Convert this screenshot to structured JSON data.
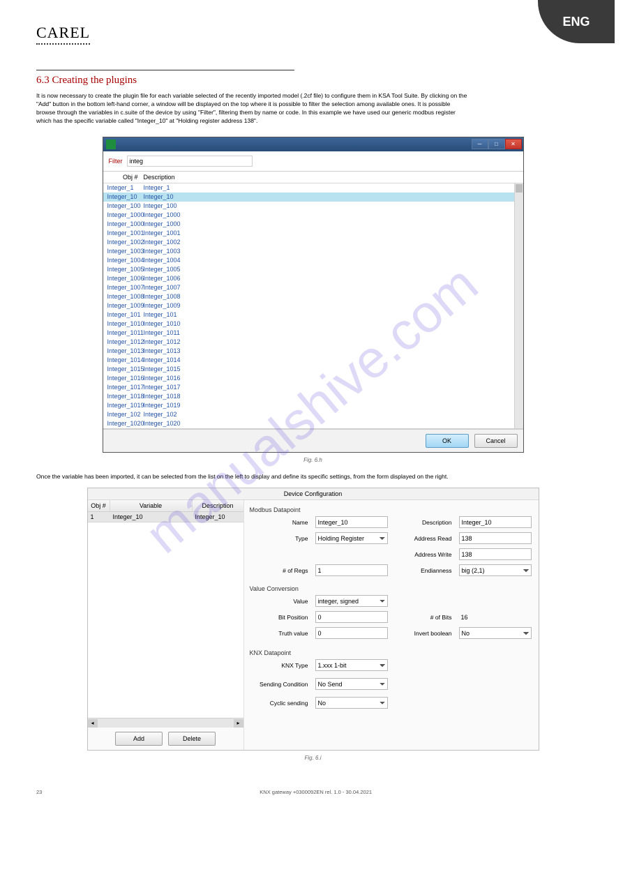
{
  "brand": "CAREL",
  "corner_tab": "ENG",
  "section": {
    "heading": "6.3 Creating the plugins",
    "p1": "It is now necessary to create the plugin file for each variable selected of the recently imported model (.2cf file) to configure them in KSA Tool Suite. By clicking on the \"Add\" button in the bottom left-hand corner, a window will be displayed on the top where it is possible to filter the selection among available ones. It is possible browse through the variables in c.suite of the device by using \"Filter\", filtering them by name or code. In this example we have used our generic modbus register which has the specific variable called \"Integer_10\" at \"Holding register address 138\".",
    "p2": "Once the variable has been imported, it can be selected from the list on the left to display and define its specific settings, from the form displayed on the right.",
    "fig1": "Fig. 6.h",
    "fig2": "Fig. 6.i"
  },
  "dialog1": {
    "filter_label": "Filter",
    "filter_value": "integ",
    "col_obj": "Obj #",
    "col_desc": "Description",
    "selected_index": 1,
    "rows": [
      {
        "obj": "Integer_1",
        "desc": "Integer_1"
      },
      {
        "obj": "Integer_10",
        "desc": "Integer_10"
      },
      {
        "obj": "Integer_100",
        "desc": "Integer_100"
      },
      {
        "obj": "Integer_1000",
        "desc": "Integer_1000"
      },
      {
        "obj": "Integer_1000",
        "desc": "Integer_1000"
      },
      {
        "obj": "Integer_1001",
        "desc": "Integer_1001"
      },
      {
        "obj": "Integer_1002",
        "desc": "Integer_1002"
      },
      {
        "obj": "Integer_1003",
        "desc": "Integer_1003"
      },
      {
        "obj": "Integer_1004",
        "desc": "Integer_1004"
      },
      {
        "obj": "Integer_1005",
        "desc": "Integer_1005"
      },
      {
        "obj": "Integer_1006",
        "desc": "Integer_1006"
      },
      {
        "obj": "Integer_1007",
        "desc": "Integer_1007"
      },
      {
        "obj": "Integer_1008",
        "desc": "Integer_1008"
      },
      {
        "obj": "Integer_1009",
        "desc": "Integer_1009"
      },
      {
        "obj": "Integer_101",
        "desc": "Integer_101"
      },
      {
        "obj": "Integer_1010",
        "desc": "Integer_1010"
      },
      {
        "obj": "Integer_1011",
        "desc": "Integer_1011"
      },
      {
        "obj": "Integer_1012",
        "desc": "Integer_1012"
      },
      {
        "obj": "Integer_1013",
        "desc": "Integer_1013"
      },
      {
        "obj": "Integer_1014",
        "desc": "Integer_1014"
      },
      {
        "obj": "Integer_1015",
        "desc": "Integer_1015"
      },
      {
        "obj": "Integer_1016",
        "desc": "Integer_1016"
      },
      {
        "obj": "Integer_1017",
        "desc": "Integer_1017"
      },
      {
        "obj": "Integer_1018",
        "desc": "Integer_1018"
      },
      {
        "obj": "Integer_1019",
        "desc": "Integer_1019"
      },
      {
        "obj": "Integer_102",
        "desc": "Integer_102"
      },
      {
        "obj": "Integer_1020",
        "desc": "Integer_1020"
      }
    ],
    "ok": "OK",
    "cancel": "Cancel"
  },
  "dialog2": {
    "title": "Device Configuration",
    "left": {
      "col_obj": "Obj #",
      "col_var": "Variable",
      "col_desc": "Description",
      "row": {
        "obj": "1",
        "var": "Integer_10",
        "desc": "Integer_10"
      },
      "add": "Add",
      "delete": "Delete"
    },
    "right": {
      "grp_modbus": "Modbus Datapoint",
      "name_label": "Name",
      "name_value": "Integer_10",
      "desc_label": "Description",
      "desc_value": "Integer_10",
      "type_label": "Type",
      "type_value": "Holding Register",
      "addr_read_label": "Address Read",
      "addr_read_value": "138",
      "addr_write_label": "Address Write",
      "addr_write_value": "138",
      "regs_label": "# of Regs",
      "regs_value": "1",
      "endian_label": "Endianness",
      "endian_value": "big (2,1)",
      "grp_value": "Value Conversion",
      "value_label": "Value",
      "value_value": "integer, signed",
      "bitpos_label": "Bit Position",
      "bitpos_value": "0",
      "nbits_label": "# of Bits",
      "nbits_value": "16",
      "truth_label": "Truth value",
      "truth_value": "0",
      "invbool_label": "Invert boolean",
      "invbool_value": "No",
      "grp_knx": "KNX Datapoint",
      "knxtype_label": "KNX Type",
      "knxtype_value": "1.xxx     1-bit",
      "sendcond_label": "Sending Condition",
      "sendcond_value": "No Send",
      "cyclic_label": "Cyclic sending",
      "cyclic_value": "No"
    }
  },
  "footer": {
    "left": "23",
    "center": "KNX gateway  +0300092EN rel. 1.0 - 30.04.2021"
  },
  "watermark": "manualshive.com"
}
